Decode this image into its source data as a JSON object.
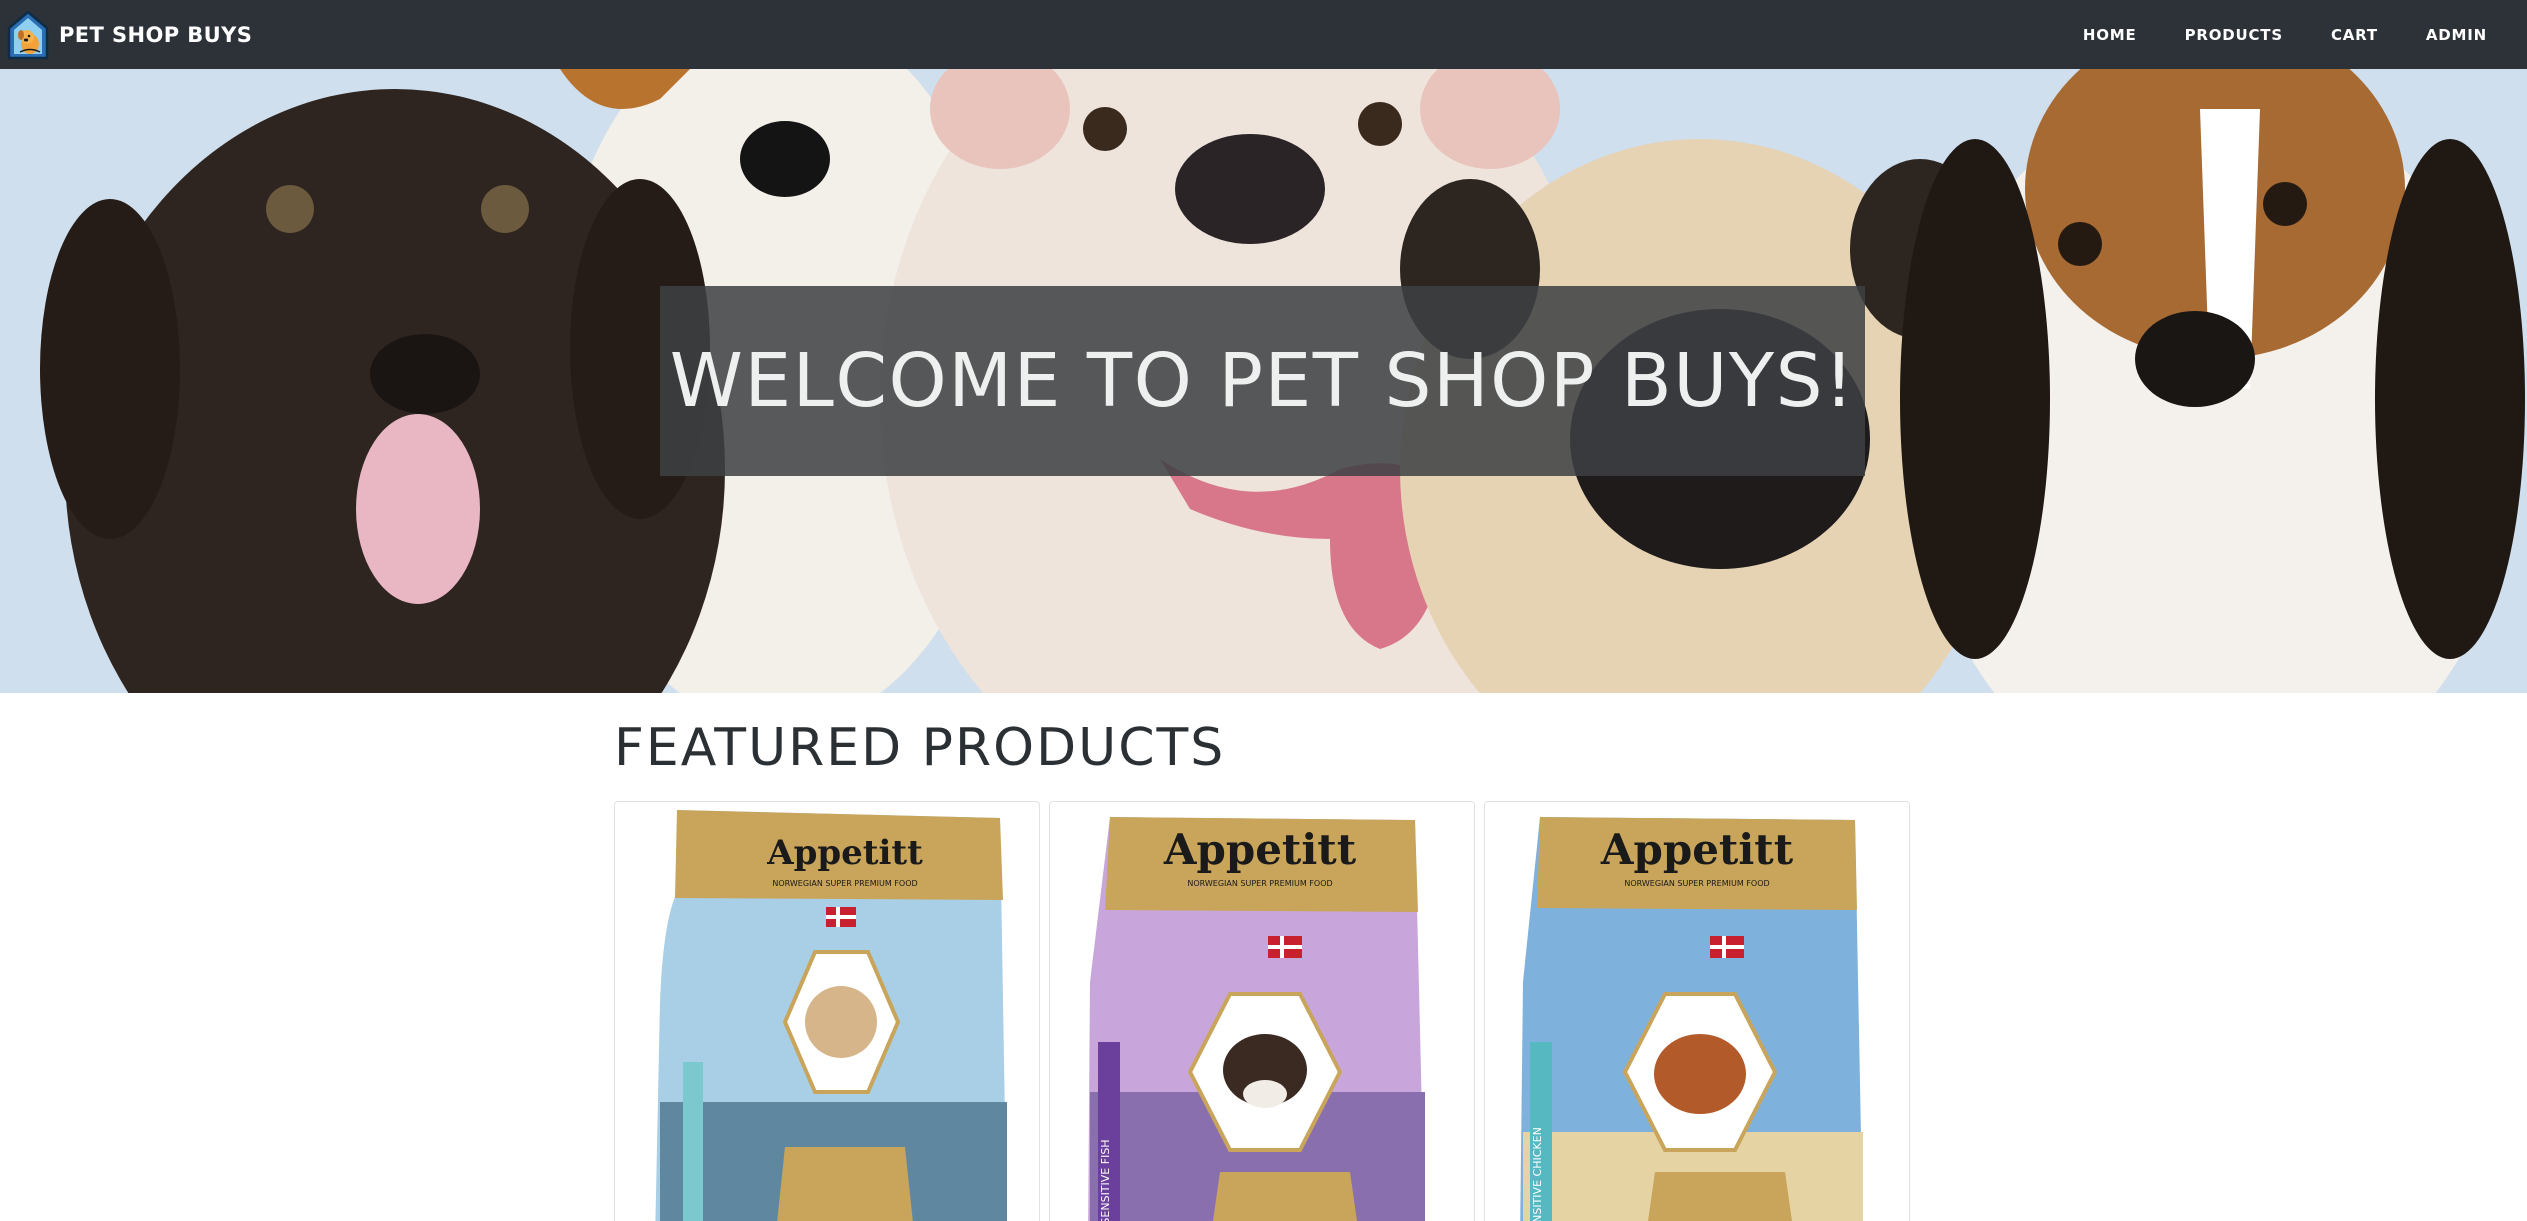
{
  "navbar": {
    "brand": "PET SHOP BUYS",
    "logo_icon": "dog-house-logo-icon",
    "links": [
      {
        "label": "HOME"
      },
      {
        "label": "PRODUCTS"
      },
      {
        "label": "CART"
      },
      {
        "label": "ADMIN"
      }
    ]
  },
  "hero": {
    "title": "WELCOME TO PET SHOP BUYS!",
    "image": "group-of-puppies-photo"
  },
  "featured": {
    "title": "FEATURED PRODUCTS",
    "products": [
      {
        "brand": "Appetitt",
        "tagline": "NORWEGIAN SUPER PREMIUM FOOD",
        "flavor": "",
        "image": "dog-food-bag-terrier",
        "accent": "#7cc8cf"
      },
      {
        "brand": "Appetitt",
        "tagline": "NORWEGIAN SUPER PREMIUM FOOD",
        "flavor": "SENSITIVE FISH",
        "image": "dog-food-bag-spaniel",
        "accent": "#6b3f9c"
      },
      {
        "brand": "Appetitt",
        "tagline": "NORWEGIAN SUPER PREMIUM FOOD",
        "flavor": "SENSITIVE CHICKEN",
        "image": "dog-food-bag-cocker",
        "accent": "#56b8c0"
      }
    ]
  },
  "colors": {
    "navbar_bg": "#2c3237",
    "hero_bg": "#cfdfee",
    "banner_bg": "#3c4043",
    "bag_gold": "#c8a55a"
  }
}
